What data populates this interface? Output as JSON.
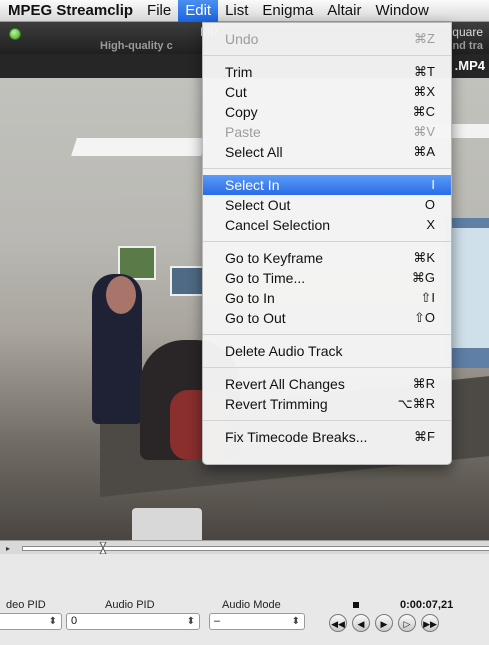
{
  "menubar": {
    "app": "MPEG Streamclip",
    "items": [
      "File",
      "Edit",
      "List",
      "Enigma",
      "Altair",
      "Window"
    ]
  },
  "window": {
    "title_left": "MP",
    "title_right": "quare",
    "subtitle_left": "High-quality c",
    "subtitle_right": "nd tra",
    "file_tail": ".MP4"
  },
  "edit_menu": {
    "undo": {
      "label": "Undo",
      "shortcut": "⌘Z"
    },
    "trim": {
      "label": "Trim",
      "shortcut": "⌘T"
    },
    "cut": {
      "label": "Cut",
      "shortcut": "⌘X"
    },
    "copy": {
      "label": "Copy",
      "shortcut": "⌘C"
    },
    "paste": {
      "label": "Paste",
      "shortcut": "⌘V"
    },
    "select_all": {
      "label": "Select All",
      "shortcut": "⌘A"
    },
    "select_in": {
      "label": "Select In",
      "shortcut": "I"
    },
    "select_out": {
      "label": "Select Out",
      "shortcut": "O"
    },
    "cancel_selection": {
      "label": "Cancel Selection",
      "shortcut": "X"
    },
    "go_keyframe": {
      "label": "Go to Keyframe",
      "shortcut": "⌘K"
    },
    "go_time": {
      "label": "Go to Time...",
      "shortcut": "⌘G"
    },
    "go_in": {
      "label": "Go to In",
      "shortcut": "⇧I"
    },
    "go_out": {
      "label": "Go to Out",
      "shortcut": "⇧O"
    },
    "delete_audio": {
      "label": "Delete Audio Track",
      "shortcut": ""
    },
    "revert_all": {
      "label": "Revert All Changes",
      "shortcut": "⌘R"
    },
    "revert_trim": {
      "label": "Revert Trimming",
      "shortcut": "⌥⌘R"
    },
    "fix_timecode": {
      "label": "Fix Timecode Breaks...",
      "shortcut": "⌘F"
    }
  },
  "controls": {
    "video_pid_label": "deo PID",
    "audio_pid_label": "Audio PID",
    "audio_mode_label": "Audio Mode",
    "audio_pid_value": "0",
    "audio_mode_value": "–",
    "timecode": "0:00:07,21"
  },
  "transport": {
    "rewind": "◀◀",
    "step_back": "◀",
    "play": "▶",
    "step_forward": "▷",
    "fast_forward": "▶▶"
  }
}
